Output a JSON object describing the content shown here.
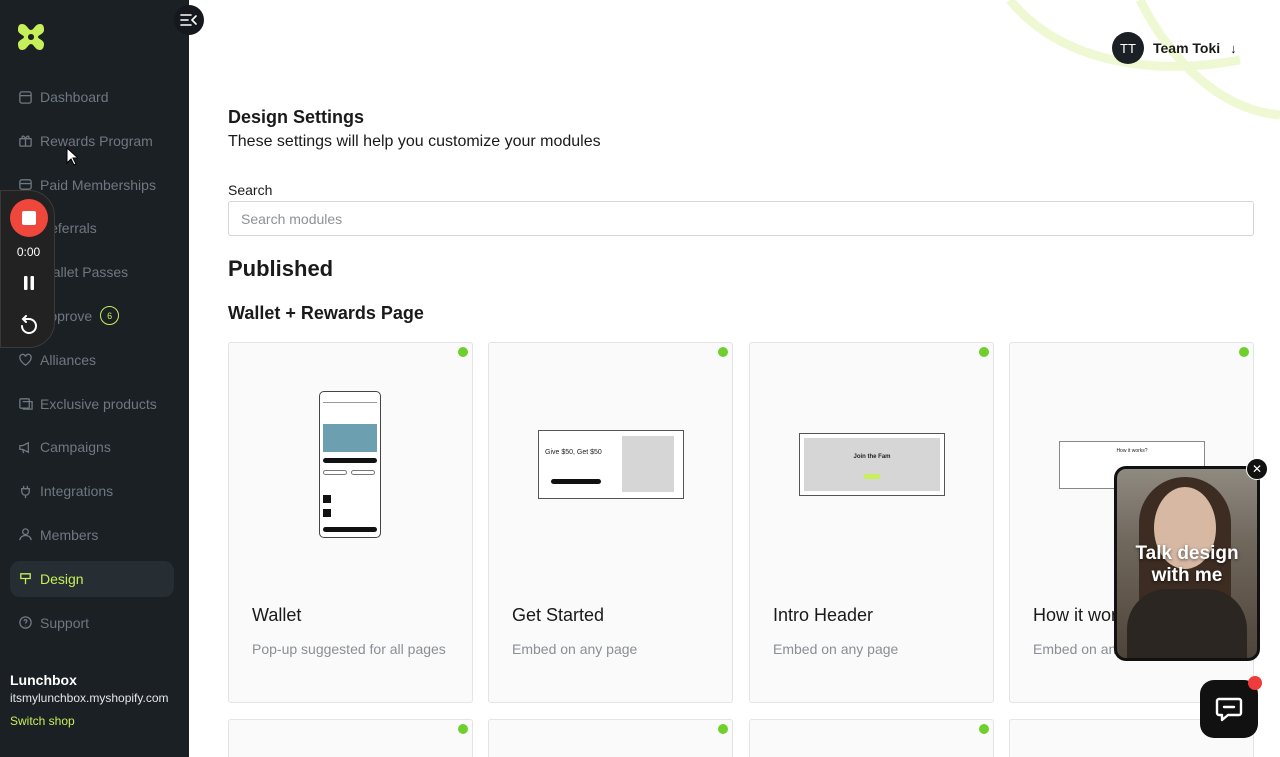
{
  "sidebar": {
    "collapse_icon": "collapse-menu-icon",
    "items": [
      {
        "label": "Dashboard",
        "icon": "dashboard-icon"
      },
      {
        "label": "Rewards Program",
        "icon": "gift-icon"
      },
      {
        "label": "Paid Memberships",
        "icon": "card-icon"
      },
      {
        "label": "Referrals",
        "icon": "referral-icon"
      },
      {
        "label": "Wallet Passes",
        "icon": "wallet-icon"
      },
      {
        "label": "Approve",
        "icon": "approve-icon",
        "badge": "6"
      },
      {
        "label": "Alliances",
        "icon": "heart-icon"
      },
      {
        "label": "Exclusive products",
        "icon": "box-icon"
      },
      {
        "label": "Campaigns",
        "icon": "megaphone-icon"
      },
      {
        "label": "Integrations",
        "icon": "plug-icon"
      },
      {
        "label": "Members",
        "icon": "members-icon"
      },
      {
        "label": "Design",
        "icon": "brush-icon",
        "active": true
      },
      {
        "label": "Support",
        "icon": "help-icon"
      }
    ],
    "shop": {
      "name": "Lunchbox",
      "url": "itsmylunchbox.myshopify.com",
      "switch_label": "Switch shop"
    }
  },
  "recorder": {
    "time": "0:00"
  },
  "header": {
    "avatar_initials": "TT",
    "user_name": "Team Toki",
    "caret": "↓"
  },
  "main": {
    "title": "Design Settings",
    "subtitle": "These settings will help you customize your modules",
    "search_label": "Search",
    "search_placeholder": "Search modules",
    "section_title": "Published",
    "group_title": "Wallet + Rewards Page",
    "cards": [
      {
        "title": "Wallet",
        "desc": "Pop-up suggested for all pages",
        "status_color": "#6fcf2c"
      },
      {
        "title": "Get Started",
        "desc": "Embed on any page",
        "status_color": "#6fcf2c",
        "preview_heading": "Give $50, Get $50"
      },
      {
        "title": "Intro Header",
        "desc": "Embed on any page",
        "status_color": "#6fcf2c",
        "preview_heading": "Join the Fam"
      },
      {
        "title": "How it wor",
        "desc": "Embed on an",
        "status_color": "#6fcf2c",
        "preview_heading": "How it works?"
      }
    ]
  },
  "video": {
    "caption": "Talk design with me",
    "close": "✕"
  },
  "colors": {
    "sidebar_bg": "#1b2025",
    "accent": "#c7ef5a",
    "status_green": "#6fcf2c",
    "recorder_red": "#f0473c"
  }
}
